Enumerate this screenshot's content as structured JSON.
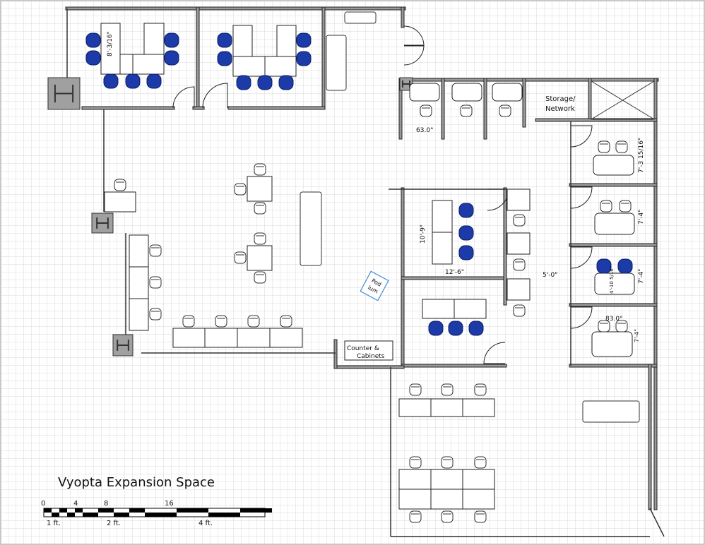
{
  "title": "Vyopta Expansion Space",
  "scale_bar": {
    "top_ticks": [
      "0",
      "4",
      "8",
      "16"
    ],
    "bottom_ticks": [
      "1 ft.",
      "2 ft.",
      "4 ft."
    ]
  },
  "rooms": {
    "storage": [
      "Storage/",
      "Network"
    ],
    "counter": [
      "Counter &",
      "Cabinets"
    ],
    "podium": [
      "Pod",
      "ium"
    ]
  },
  "dimensions": {
    "conf_room_depth": "8'-3/16\"",
    "booth_angle": "63.0°",
    "office1_depth": "7'-3 15/16\"",
    "office2_depth": "7'-4\"",
    "office3_depth": "7'-4\"",
    "office3_table": "4'-10 5/16\"",
    "office4_angle": "83.0°",
    "office4_depth": "7'-4\"",
    "meeting_depth": "10'-9\"",
    "meeting_width": "12'-6\"",
    "corridor_width": "5'-0\""
  },
  "colors": {
    "chair_blue": "#1c3aa8",
    "wall": "#9a9a9a",
    "grid": "#d9d9d9",
    "podium": "#3d8fd6"
  }
}
